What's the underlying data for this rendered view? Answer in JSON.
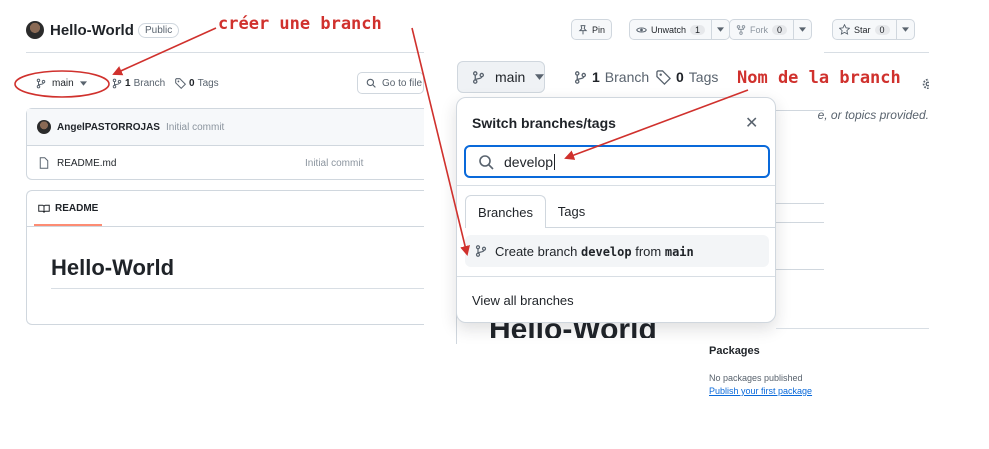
{
  "repo": {
    "name": "Hello-World",
    "visibility": "Public"
  },
  "header_actions": {
    "pin": "Pin",
    "unwatch": "Unwatch",
    "unwatch_count": "1",
    "fork": "Fork",
    "fork_count": "0",
    "star": "Star",
    "star_count": "0"
  },
  "small_view": {
    "branch": "main",
    "branches_count": "1",
    "branches_label": "Branch",
    "tags_count": "0",
    "tags_label": "Tags",
    "goto_placeholder": "Go to file",
    "commit_author": "AngelPASTORROJAS",
    "commit_message": "Initial commit",
    "file_name": "README.md",
    "file_commit": "Initial commit",
    "readme_tab": "README",
    "readme_heading": "Hello-World"
  },
  "big_view": {
    "branch": "main",
    "branches_count": "1",
    "branches_label": "Branch",
    "tags_count": "0",
    "tags_label": "Tags",
    "behind_heading": "Hello-World"
  },
  "dropdown": {
    "title": "Switch branches/tags",
    "close": "✕",
    "search_value": "develop",
    "tab_branches": "Branches",
    "tab_tags": "Tags",
    "create_prefix": "Create branch",
    "create_branch": "develop",
    "create_from": "from",
    "create_source": "main",
    "view_all": "View all branches"
  },
  "sidebar": {
    "description_fragment": "e, or topics provided.",
    "packages_heading": "Packages",
    "packages_text": "No packages published",
    "packages_link": "Publish your first package"
  },
  "annotations": {
    "create_branch": "créer une branch",
    "branch_name": "Nom de la branch",
    "color": "#d0312d"
  }
}
